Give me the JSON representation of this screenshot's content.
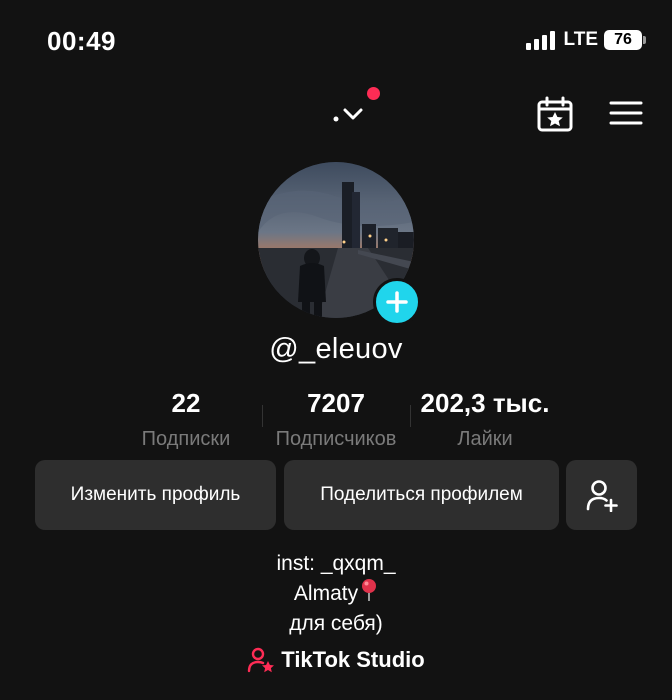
{
  "status_bar": {
    "time": "00:49",
    "network": "LTE",
    "battery": "76"
  },
  "header": {
    "icons": [
      "chevron-down-icon",
      "calendar-star-icon",
      "hamburger-menu-icon"
    ],
    "notification_dot_color": "#fe2c55"
  },
  "profile": {
    "username": "@_eleuov",
    "avatar": "night-city-photo",
    "add_button_color": "#20d5ec"
  },
  "stats": [
    {
      "value": "22",
      "label": "Подписки"
    },
    {
      "value": "7207",
      "label": "Подписчиков"
    },
    {
      "value": "202,3 тыс.",
      "label": "Лайки"
    }
  ],
  "actions": {
    "edit_profile": "Изменить профиль",
    "share_profile": "Поделиться профилем",
    "add_friends_icon": "person-add-icon"
  },
  "bio": {
    "lines": [
      "inst: _qxqm_",
      "Almaty",
      "для себя)"
    ],
    "pin_icon": "round-pushpin-icon"
  },
  "studio": {
    "label": "TikTok Studio",
    "icon": "person-star-icon",
    "accent": "#fe2c55"
  }
}
